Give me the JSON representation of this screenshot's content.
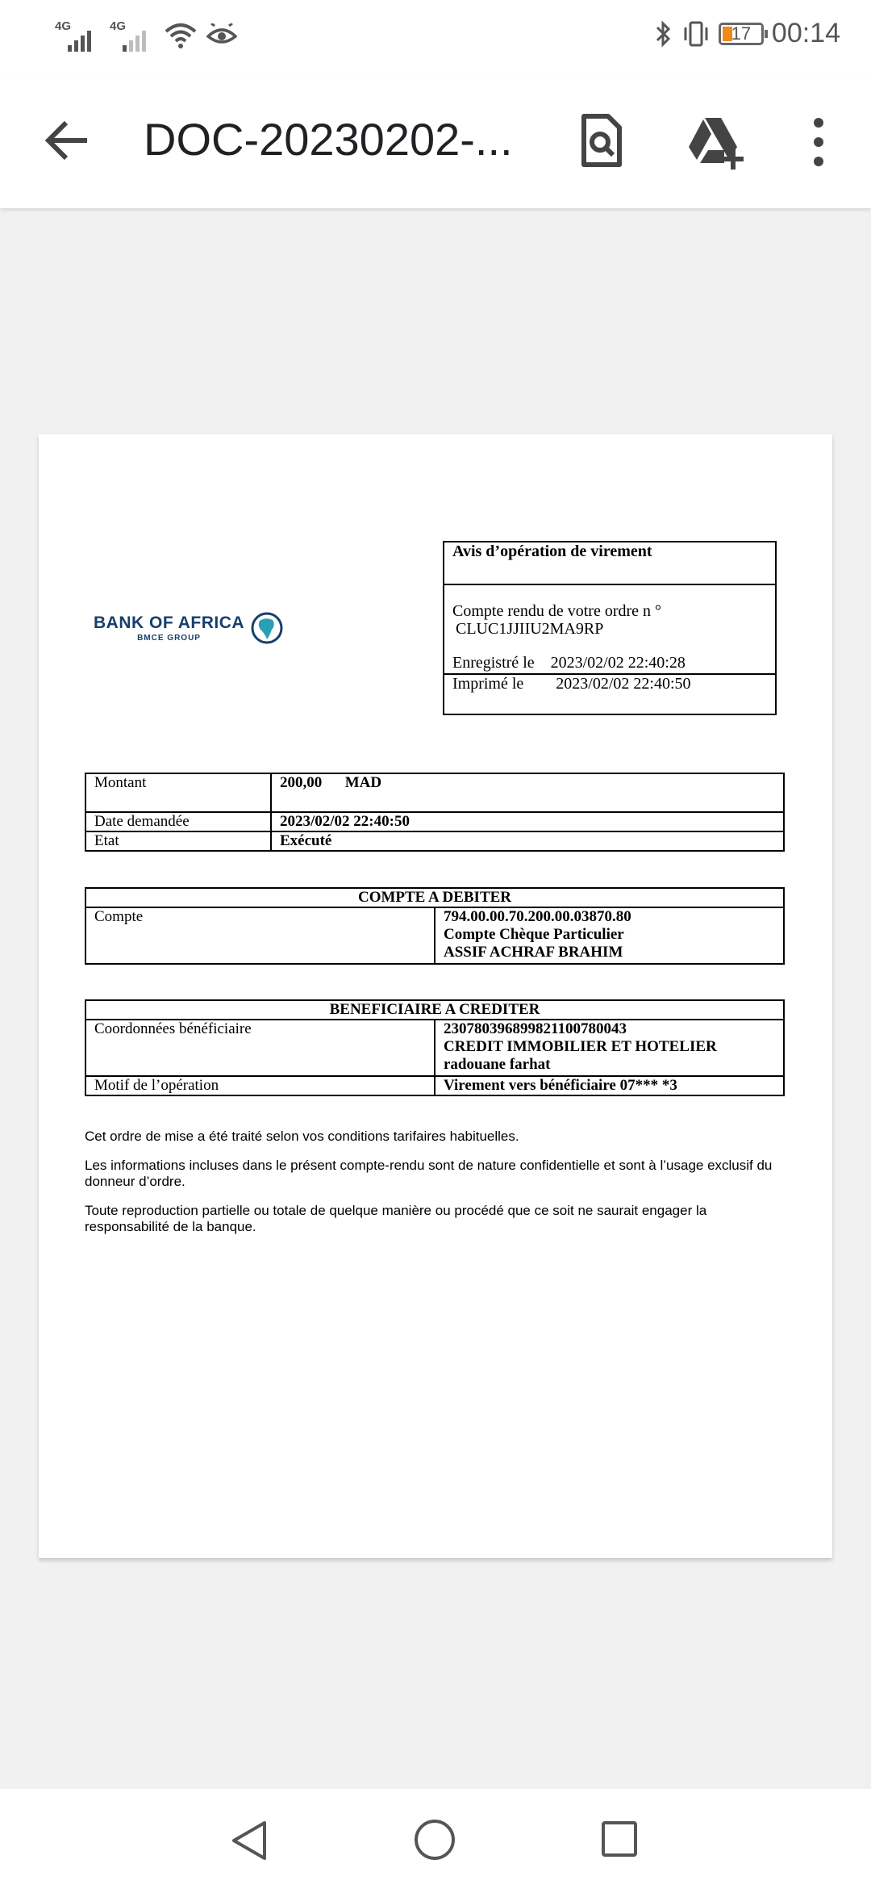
{
  "status_bar": {
    "signal1_label": "4G",
    "signal2_label": "4G",
    "battery_level": "17",
    "time": "00:14",
    "icons": [
      "signal-icon",
      "wifi-icon",
      "eye-icon",
      "bluetooth-icon",
      "vibrate-icon",
      "battery-icon"
    ]
  },
  "app_bar": {
    "title": "DOC-20230202-...",
    "icons": [
      "back-arrow-icon",
      "search-document-icon",
      "add-to-drive-icon",
      "more-vert-icon"
    ]
  },
  "document": {
    "logo": {
      "main": "BANK OF AFRICA",
      "sub": "BMCE GROUP",
      "accent": "#2a9fb3",
      "brand": "#163f6e"
    },
    "notice": {
      "title": "Avis d’opération de virement",
      "ref_label": "Compte rendu de votre ordre n °",
      "ref_value": "CLUC1JJIIU2MA9RP",
      "registered": "Enregistré le    2023/02/02 22:40:28",
      "printed": "Imprimé le        2023/02/02 22:40:50"
    },
    "summary": [
      {
        "label": "Montant",
        "value": "200,00      MAD"
      },
      {
        "label": "Date demandée",
        "value": "2023/02/02 22:40:50"
      },
      {
        "label": "Etat",
        "value": "Exécuté"
      }
    ],
    "debit": {
      "header": "COMPTE A DEBITER",
      "label": "Compte",
      "lines": [
        "794.00.00.70.200.00.03870.80",
        "Compte Chèque Particulier",
        "ASSIF ACHRAF BRAHIM"
      ]
    },
    "credit": {
      "header": "BENEFICIAIRE A CREDITER",
      "coords_label": "Coordonnées bénéficiaire",
      "coords_lines": [
        "230780396899821100780043",
        "CREDIT IMMOBILIER ET HOTELIER",
        "radouane farhat"
      ],
      "motif_label": "Motif de l’opération",
      "motif_value": "Virement vers bénéficiaire 07*** *3"
    },
    "notes": [
      "Cet ordre de mise a été traité selon vos conditions tarifaires habituelles.",
      "Les informations incluses dans le présent compte-rendu sont de nature confidentielle et sont à l’usage exclusif du donneur d’ordre.",
      "Toute reproduction partielle ou totale de quelque manière ou procédé que ce soit ne saurait engager la responsabilité de la banque."
    ]
  },
  "nav_bar": {
    "icons": [
      "nav-back-icon",
      "nav-home-icon",
      "nav-recents-icon"
    ]
  }
}
